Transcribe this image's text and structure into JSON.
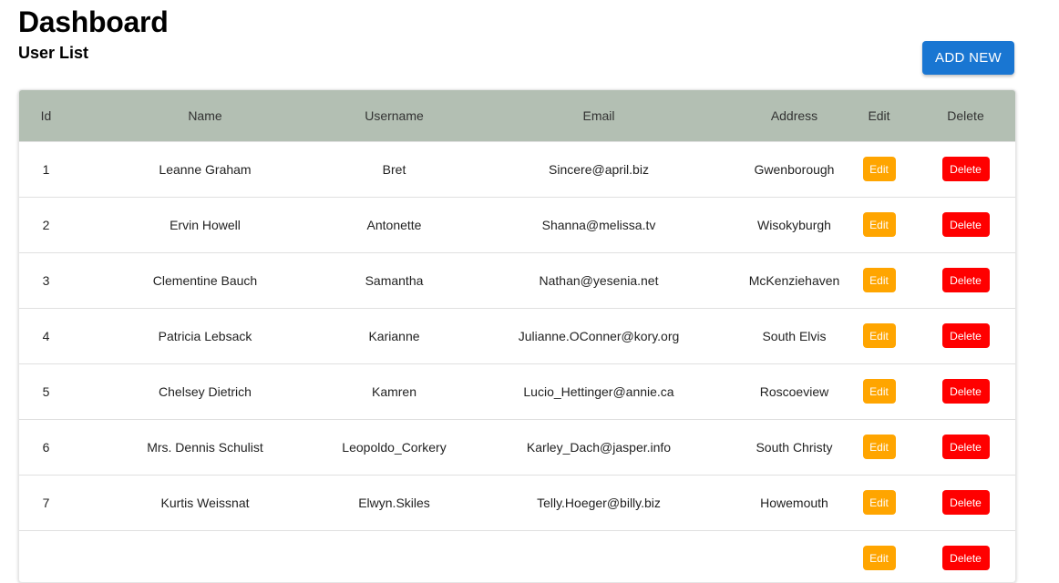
{
  "header": {
    "title": "Dashboard",
    "subtitle": "User List",
    "add_label": "ADD NEW"
  },
  "table": {
    "columns": [
      "Id",
      "Name",
      "Username",
      "Email",
      "Address",
      "Edit",
      "Delete"
    ],
    "edit_label": "Edit",
    "delete_label": "Delete",
    "rows": [
      {
        "id": "1",
        "name": "Leanne Graham",
        "username": "Bret",
        "email": "Sincere@april.biz",
        "address": "Gwenborough"
      },
      {
        "id": "2",
        "name": "Ervin Howell",
        "username": "Antonette",
        "email": "Shanna@melissa.tv",
        "address": "Wisokyburgh"
      },
      {
        "id": "3",
        "name": "Clementine Bauch",
        "username": "Samantha",
        "email": "Nathan@yesenia.net",
        "address": "McKenziehaven"
      },
      {
        "id": "4",
        "name": "Patricia Lebsack",
        "username": "Karianne",
        "email": "Julianne.OConner@kory.org",
        "address": "South Elvis"
      },
      {
        "id": "5",
        "name": "Chelsey Dietrich",
        "username": "Kamren",
        "email": "Lucio_Hettinger@annie.ca",
        "address": "Roscoeview"
      },
      {
        "id": "6",
        "name": "Mrs. Dennis Schulist",
        "username": "Leopoldo_Corkery",
        "email": "Karley_Dach@jasper.info",
        "address": "South Christy"
      },
      {
        "id": "7",
        "name": "Kurtis Weissnat",
        "username": "Elwyn.Skiles",
        "email": "Telly.Hoeger@billy.biz",
        "address": "Howemouth"
      },
      {
        "id": "",
        "name": "",
        "username": "",
        "email": "",
        "address": ""
      }
    ]
  },
  "colors": {
    "header_row": "#b3bfb3",
    "add_button": "#1976d2",
    "edit_button": "#ffa500",
    "delete_button": "#ff0000"
  }
}
